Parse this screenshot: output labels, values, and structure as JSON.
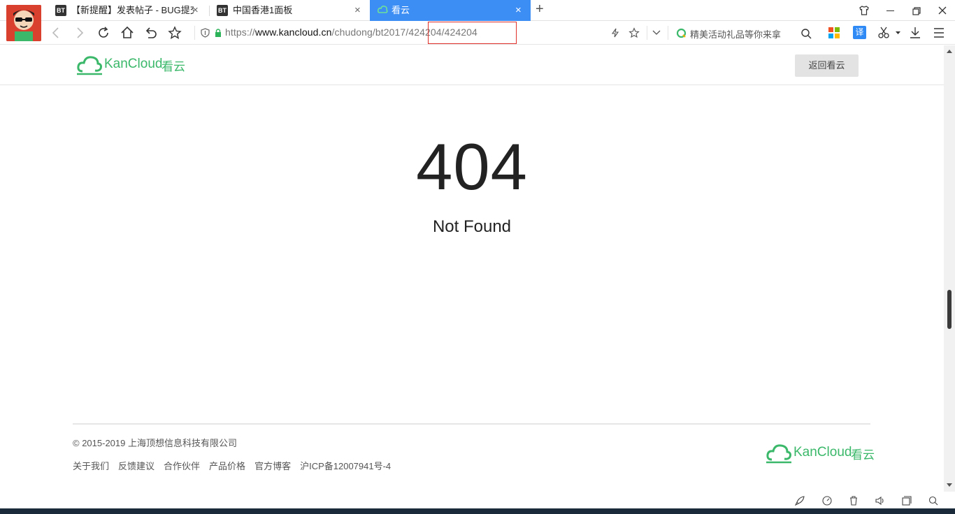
{
  "browser": {
    "tabs": [
      {
        "label": "【新提醒】发表帖子 - BUG提交",
        "favicon": "BT",
        "close": "×"
      },
      {
        "label": "中国香港1面板",
        "favicon": "BT",
        "close": "×"
      },
      {
        "label": "看云",
        "favicon": "kancloud-logo",
        "close": "×"
      }
    ],
    "new_tab": "+",
    "address": {
      "scheme": "https://",
      "domain": "www.kancloud.cn",
      "path": "/chudong/bt2017/",
      "path_tail": "424204/424204"
    },
    "search_promo": "精美活动礼品等你来拿",
    "translate_label": "译"
  },
  "page": {
    "logo_text": "KanCloud",
    "logo_cn": "看云",
    "back_button": "返回看云",
    "error_code": "404",
    "error_message": "Not Found",
    "footer": {
      "copyright": "© 2015-2019 上海顶想信息科技有限公司",
      "links": [
        "关于我们",
        "反馈建议",
        "合作伙伴",
        "产品价格",
        "官方博客",
        "沪ICP备12007941号-4"
      ]
    }
  },
  "colors": {
    "brand_green": "#3bb86a",
    "active_tab": "#3c8ef5",
    "highlight_red": "#e0302a"
  }
}
